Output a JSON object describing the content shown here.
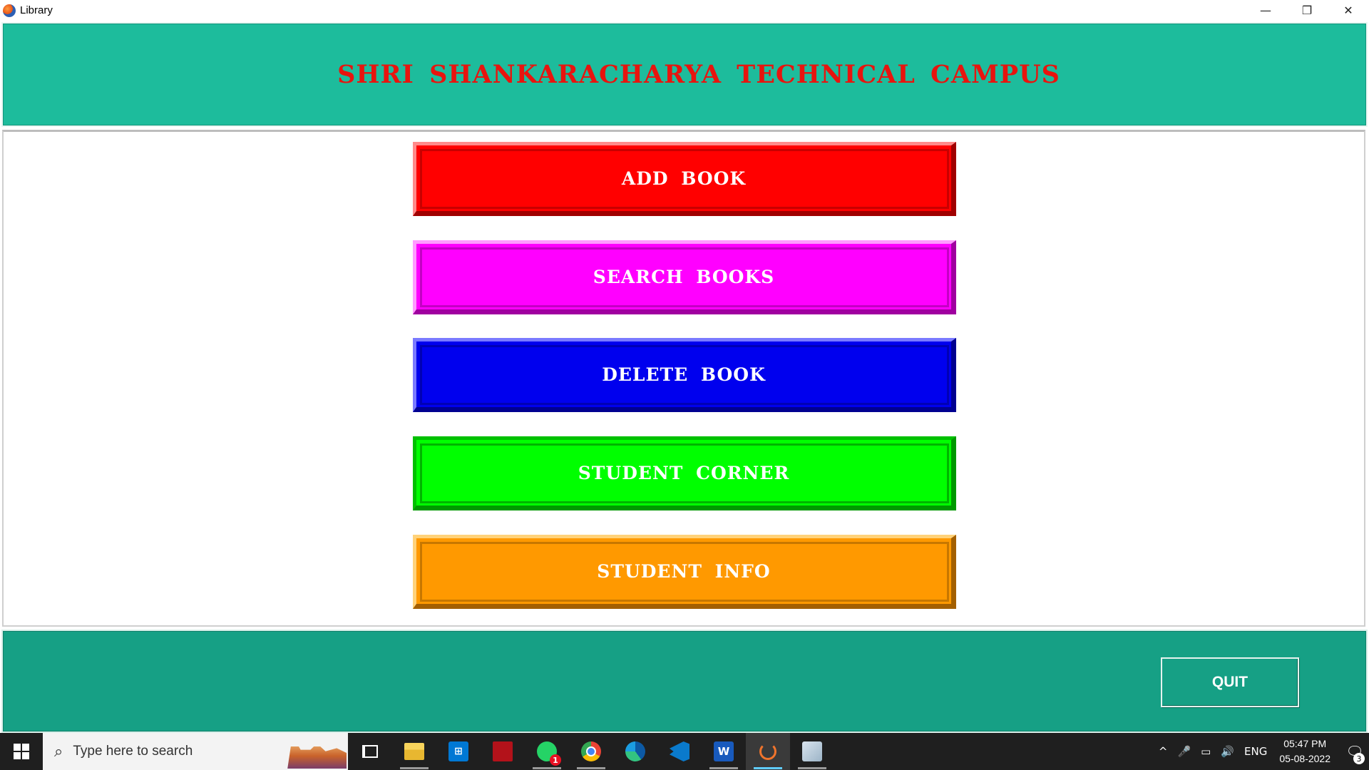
{
  "window": {
    "title": "Library",
    "controls": {
      "minimize": "—",
      "restore": "❐",
      "close": "✕"
    }
  },
  "header": {
    "title": "SHRI SHANKARACHARYA TECHNICAL CAMPUS",
    "bg_color": "#1dbc9c",
    "title_color": "#e8140e"
  },
  "menu": {
    "add_book": "ADD BOOK",
    "search_books": "SEARCH BOOKS",
    "delete_book": "DELETE BOOK",
    "student_corner": "STUDENT CORNER",
    "student_info": "STUDENT INFO",
    "colors": {
      "add": "#ff0000",
      "search": "#ff00ff",
      "delete": "#0000ee",
      "student": "#00ff00",
      "info": "#ff9900"
    }
  },
  "footer": {
    "quit_label": "QUIT",
    "bg_color": "#16a085"
  },
  "taskbar": {
    "search_placeholder": "Type here to search",
    "whatsapp_badge": "1",
    "tray": {
      "chevron": "^",
      "mic": "🎤",
      "battery": "▭",
      "volume": "🔊",
      "language": "ENG"
    },
    "time": "05:47 PM",
    "date": "05-08-2022",
    "notification_count": "3"
  }
}
